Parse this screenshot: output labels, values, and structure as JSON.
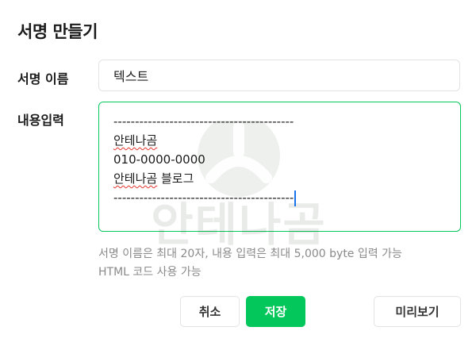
{
  "dialog": {
    "title": "서명 만들기"
  },
  "name_field": {
    "label": "서명 이름",
    "value": "텍스트"
  },
  "content_field": {
    "label": "내용입력",
    "lines": [
      "------------------------------------------",
      "안테나곰",
      "010-0000-0000",
      "안테나곰 블로그",
      "------------------------------------------"
    ],
    "squiggle_words": [
      "안테나곰"
    ]
  },
  "watermark": {
    "text": "안테나곰"
  },
  "help": {
    "line1": "서명 이름은 최대 20자, 내용 입력은 최대 5,000 byte 입력 가능",
    "line2": "HTML 코드 사용 가능"
  },
  "buttons": {
    "cancel": "취소",
    "save": "저장",
    "preview": "미리보기"
  },
  "colors": {
    "accent": "#03c75a",
    "border": "#e3e3e3",
    "help_text": "#8a8a8a",
    "spell_error": "#e5322d",
    "caret": "#1a73e8"
  }
}
